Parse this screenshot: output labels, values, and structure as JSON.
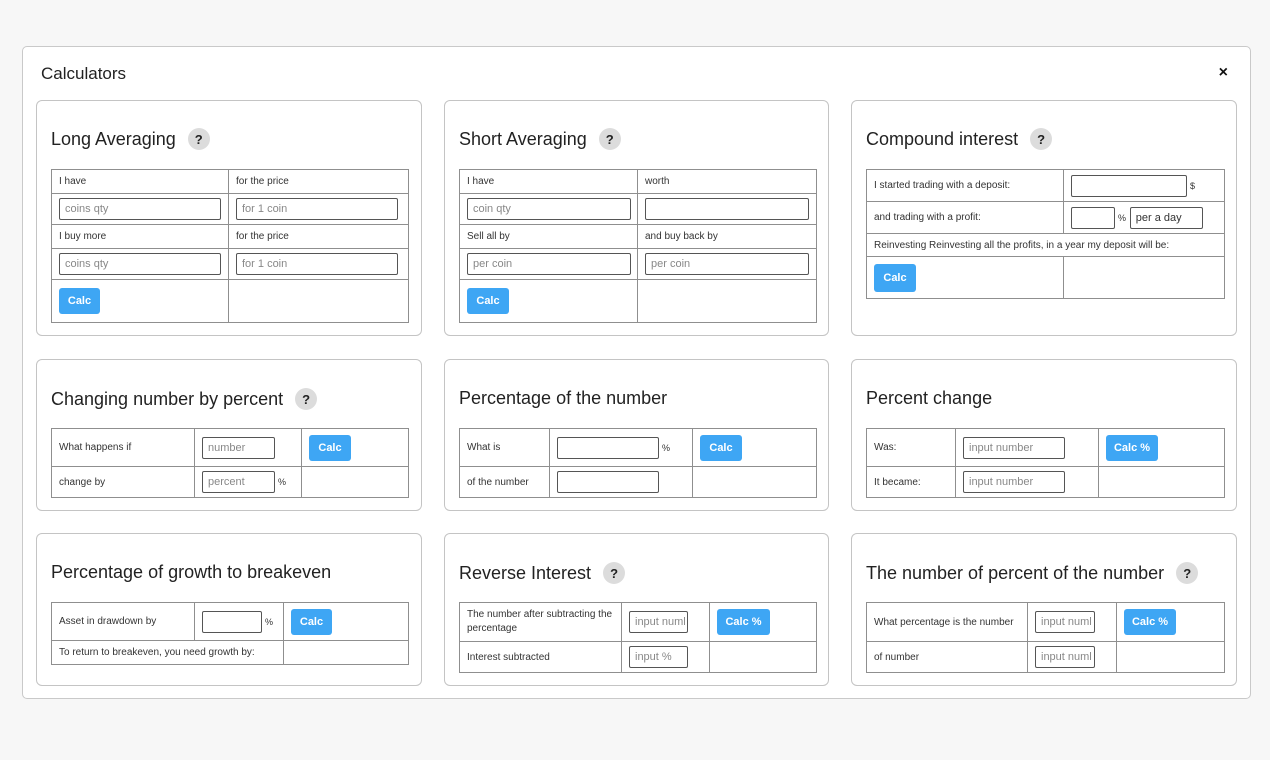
{
  "modal": {
    "title": "Calculators",
    "close": "×"
  },
  "help_label": "?",
  "long": {
    "title": "Long Averaging",
    "have": "I have",
    "for_price": "for the price",
    "coins_ph": "coins qty",
    "coin_ph": "for 1 coin",
    "buy_more": "I buy more",
    "for_price2": "for the price",
    "calc": "Calc"
  },
  "short": {
    "title": "Short Averaging",
    "have": "I have",
    "worth": "worth",
    "coin_ph": "coin qty",
    "worth_ph": "",
    "sell_all": "Sell all by",
    "buy_back": "and buy back by",
    "per_coin": "per coin",
    "calc": "Calc"
  },
  "compound": {
    "title": "Compound interest",
    "deposit": "I started trading with a deposit:",
    "deposit_unit": "$",
    "profit": "and trading with a profit:",
    "profit_unit": "%",
    "period": "per a day",
    "reinvest": "Reinvesting Reinvesting all the profits, in a year my deposit will be:",
    "calc": "Calc"
  },
  "changing": {
    "title": "Changing number by percent",
    "what": "What happens if",
    "number_ph": "number",
    "change_by": "change by",
    "percent_ph": "percent",
    "unit": "%",
    "calc": "Calc"
  },
  "percentage_of": {
    "title": "Percentage of the number",
    "what_is": "What is",
    "unit": "%",
    "of_number": "of the number",
    "calc": "Calc"
  },
  "percent_change": {
    "title": "Percent change",
    "was": "Was:",
    "became": "It became:",
    "input_ph": "input number",
    "calc": "Calc %"
  },
  "breakeven": {
    "title": "Percentage of growth to breakeven",
    "asset": "Asset in drawdown by",
    "unit": "%",
    "result": "To return to breakeven, you need growth by:",
    "calc": "Calc"
  },
  "reverse": {
    "title": "Reverse Interest",
    "after": "The number after subtracting the percentage",
    "input_ph": "input numl",
    "subtracted": "Interest subtracted",
    "pct_ph": "input %",
    "calc": "Calc %"
  },
  "number_of_percent": {
    "title": "The number of percent of the number",
    "what_pct": "What percentage is the number",
    "input_ph": "input numl",
    "of_number": "of number",
    "input_ph2": "input numl",
    "calc": "Calc %"
  }
}
